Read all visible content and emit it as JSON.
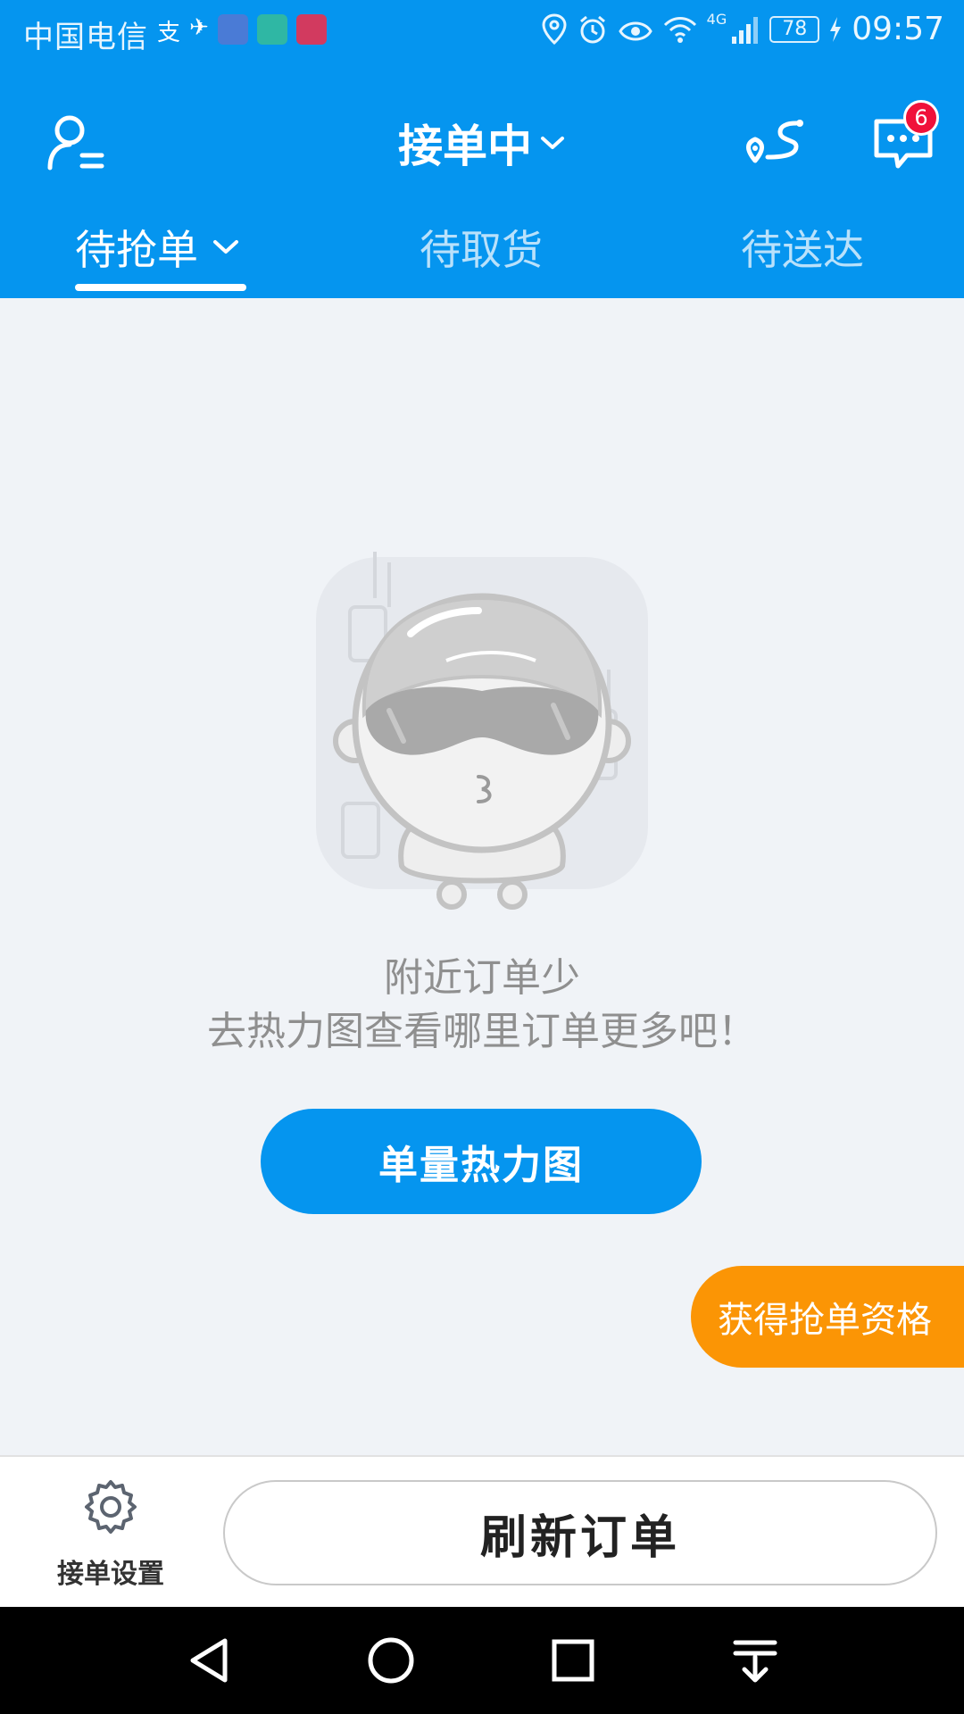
{
  "status_bar": {
    "carrier": "中国电信",
    "network": "4G",
    "battery": "78",
    "time": "09:57"
  },
  "header": {
    "title": "接单中",
    "message_badge": "6",
    "icons": {
      "left": "profile-menu-icon",
      "route": "route-icon",
      "messages": "message-icon"
    }
  },
  "tabs": [
    {
      "label": "待抢单",
      "active": true
    },
    {
      "label": "待取货",
      "active": false
    },
    {
      "label": "待送达",
      "active": false
    }
  ],
  "empty_state": {
    "line1": "附近订单少",
    "line2": "去热力图查看哪里订单更多吧！",
    "illustration": "mascot-with-sunglasses"
  },
  "buttons": {
    "heatmap": "单量热力图",
    "qualify": "获得抢单资格",
    "settings": "接单设置",
    "refresh": "刷新订单"
  },
  "colors": {
    "brand_blue": "#0595ef",
    "orange": "#fb9505",
    "badge_red": "#f0113a"
  }
}
